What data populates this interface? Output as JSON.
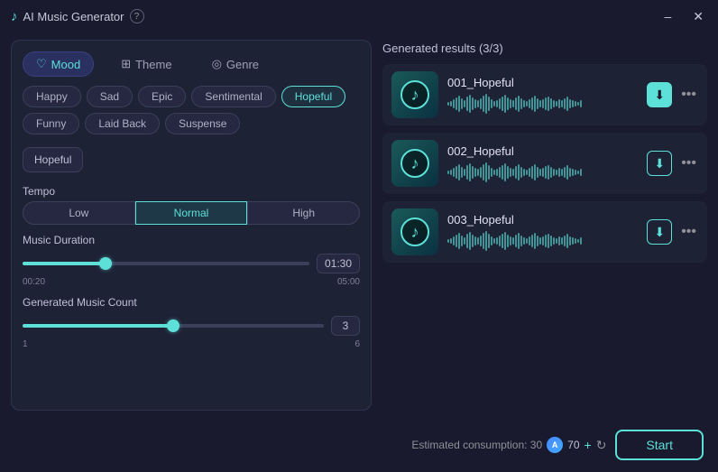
{
  "titleBar": {
    "title": "AI Music Generator",
    "minimizeLabel": "–",
    "closeLabel": "✕"
  },
  "leftPanel": {
    "tabs": [
      {
        "id": "mood",
        "label": "Mood",
        "icon": "♡",
        "active": true
      },
      {
        "id": "theme",
        "label": "Theme",
        "icon": "⊞",
        "active": false
      },
      {
        "id": "genre",
        "label": "Genre",
        "icon": "◎",
        "active": false
      }
    ],
    "moodButtons": [
      {
        "label": "Happy",
        "active": false
      },
      {
        "label": "Sad",
        "active": false
      },
      {
        "label": "Epic",
        "active": false
      },
      {
        "label": "Sentimental",
        "active": false
      },
      {
        "label": "Hopeful",
        "active": true
      },
      {
        "label": "Funny",
        "active": false
      },
      {
        "label": "Laid Back",
        "active": false
      },
      {
        "label": "Suspense",
        "active": false
      }
    ],
    "selectedMood": "Hopeful",
    "tempo": {
      "label": "Tempo",
      "options": [
        {
          "label": "Low",
          "active": false
        },
        {
          "label": "Normal",
          "active": true
        },
        {
          "label": "High",
          "active": false
        }
      ]
    },
    "musicDuration": {
      "label": "Music Duration",
      "min": "00:20",
      "max": "05:00",
      "current": "01:30",
      "sliderPercent": 28
    },
    "generatedMusicCount": {
      "label": "Generated Music Count",
      "min": "1",
      "max": "6",
      "current": "3",
      "sliderPercent": 50
    }
  },
  "bottomBar": {
    "consumptionLabel": "Estimated consumption: 30",
    "coins": "70",
    "addLabel": "+",
    "refreshLabel": "↻",
    "startLabel": "Start"
  },
  "rightPanel": {
    "header": "Generated results (3/3)",
    "results": [
      {
        "id": "001",
        "title": "001_Hopeful",
        "hasActiveDownload": true
      },
      {
        "id": "002",
        "title": "002_Hopeful",
        "hasActiveDownload": false
      },
      {
        "id": "003",
        "title": "003_Hopeful",
        "hasActiveDownload": false
      }
    ]
  }
}
